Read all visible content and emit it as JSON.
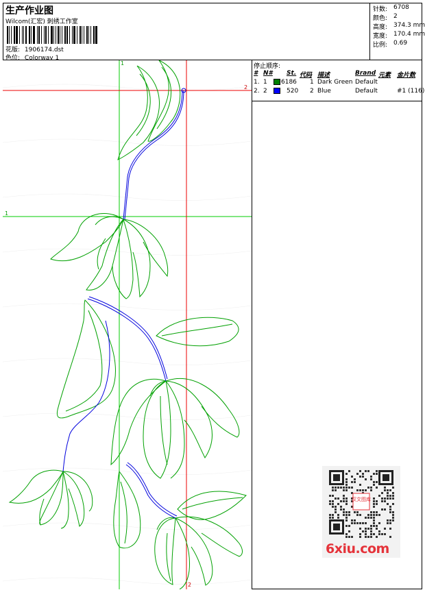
{
  "header": {
    "title": "生产作业图",
    "subtitle": "Wilcom(汇宏) 刺绣工作室",
    "design_label": "花版:",
    "design_value": "1906174.dst",
    "colorway_label": "色位:",
    "colorway_value": "Colorway 1"
  },
  "stats": [
    {
      "label": "针数:",
      "value": "6708"
    },
    {
      "label": "颜色:",
      "value": "2"
    },
    {
      "label": "高度:",
      "value": "374.3 mm"
    },
    {
      "label": "宽度:",
      "value": "170.4 mm"
    },
    {
      "label": "比例:",
      "value": "0.69"
    }
  ],
  "stop_sequence": {
    "heading": "停止顺序:",
    "columns": [
      "#",
      "N#",
      "St.",
      "代码",
      "描述",
      "Brand",
      "元素",
      "金片数"
    ],
    "rows": [
      {
        "n": "1.",
        "nn": "1",
        "color": "#008000",
        "stitches": "6186",
        "code": "1",
        "desc": "Dark Green",
        "brand": "Default",
        "element": "",
        "sequins": ""
      },
      {
        "n": "2.",
        "nn": "2",
        "color": "#0000ff",
        "stitches": "520",
        "code": "2",
        "desc": "Blue",
        "brand": "Default",
        "element": "",
        "sequins": "#1 (116)"
      }
    ]
  },
  "design_markers": {
    "h1": "1",
    "v1": "1",
    "h2": "2",
    "v2": "2"
  },
  "colors": {
    "outline": "#00a000",
    "stem": "#0000dd",
    "guide_green": "#00cc00",
    "guide_red": "#ee0000",
    "watermark": "#e5333a"
  },
  "watermark": {
    "text": "6xiu.com",
    "qr_center_text": "汉文图库"
  }
}
